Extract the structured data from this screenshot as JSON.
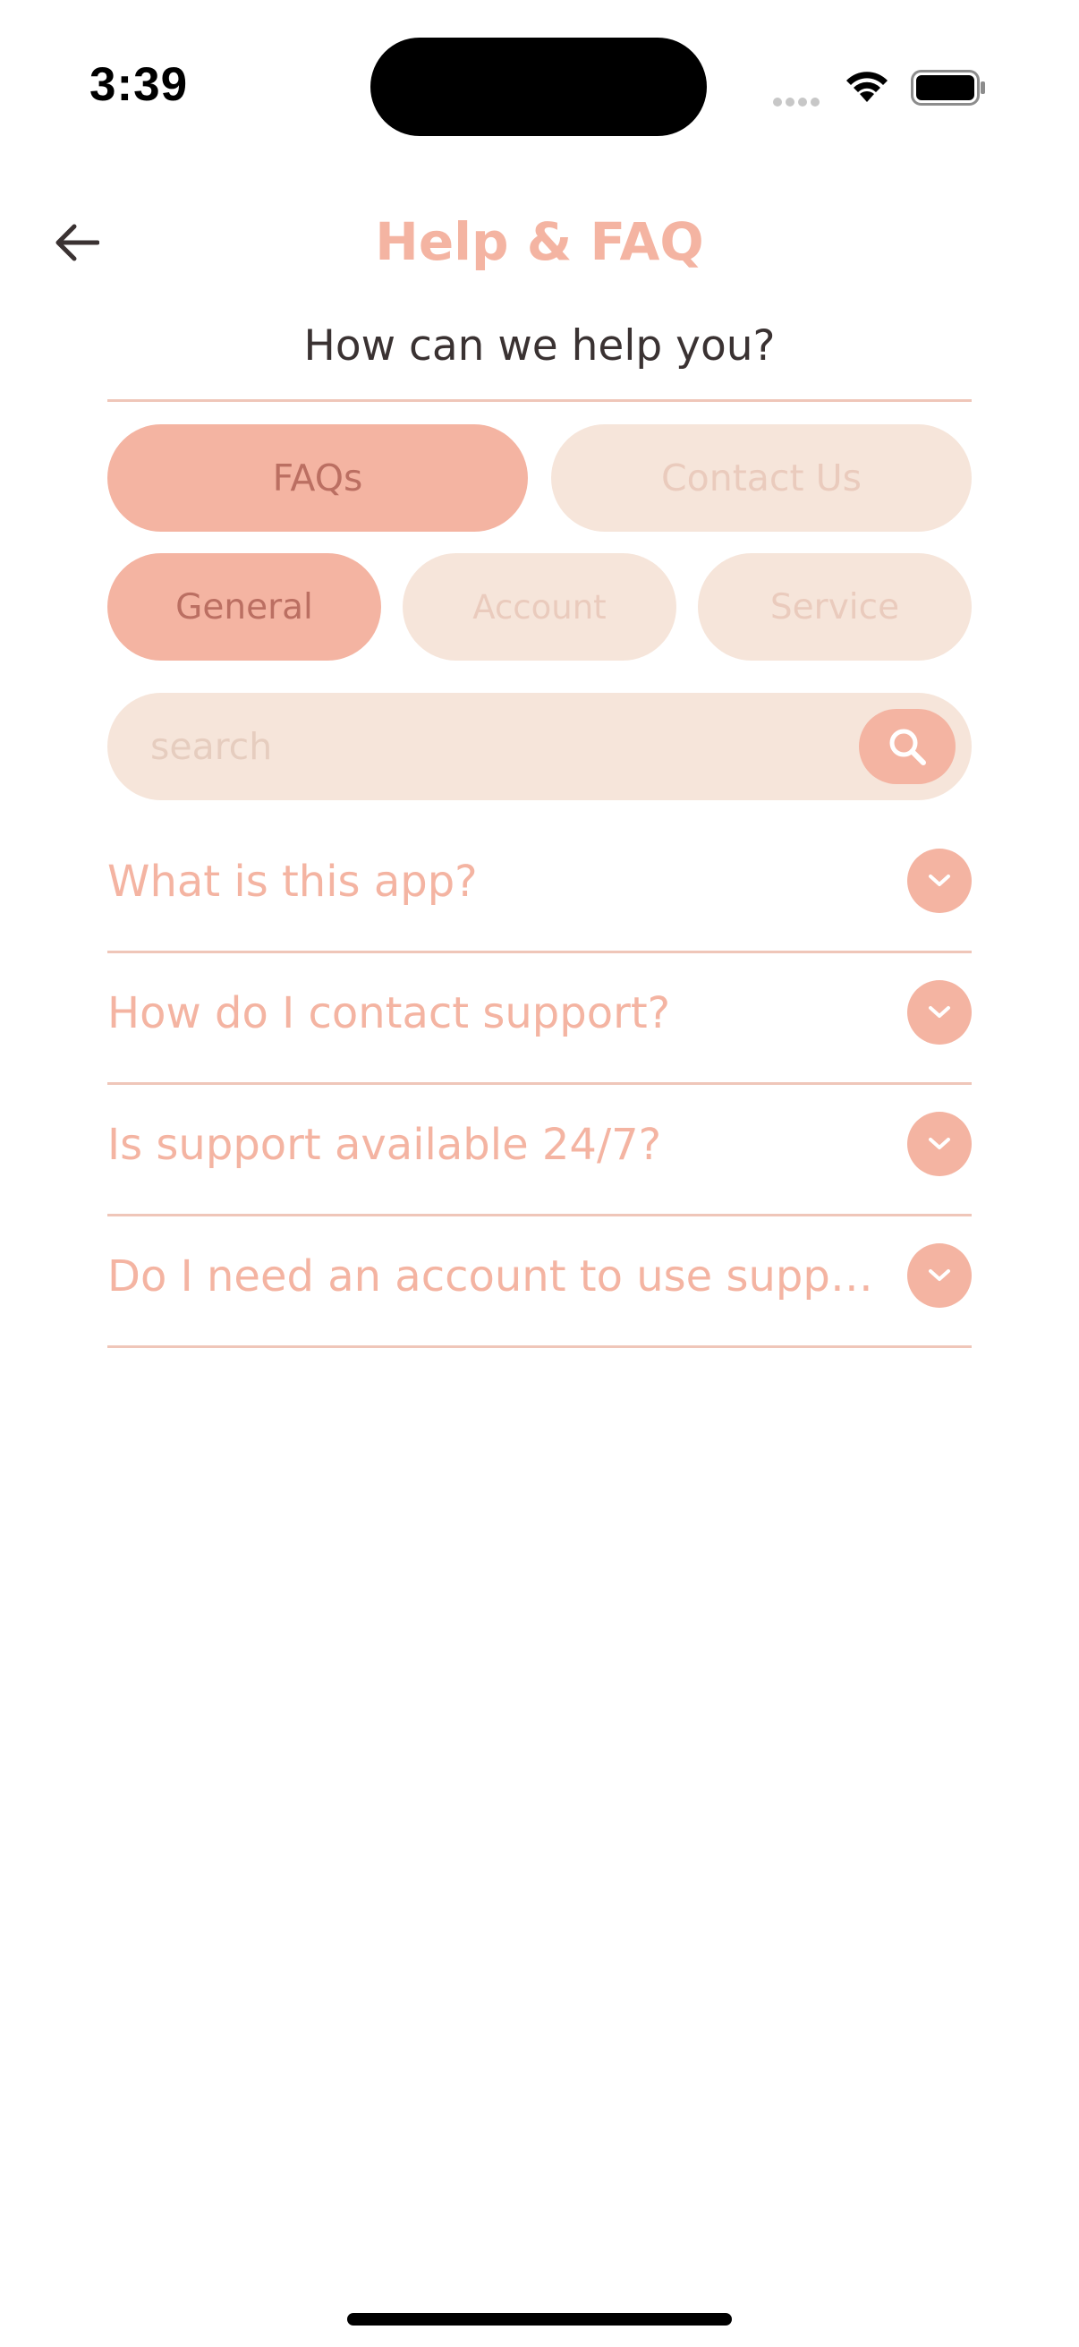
{
  "status_bar": {
    "time": "3:39",
    "icons": [
      "signal-dots-icon",
      "wifi-icon",
      "battery-icon"
    ]
  },
  "header": {
    "back_icon": "arrow-left-icon",
    "title": "Help & FAQ",
    "subtitle": "How can we help you?"
  },
  "tabs": [
    {
      "label": "FAQs",
      "active": true
    },
    {
      "label": "Contact Us",
      "active": false
    }
  ],
  "categories": [
    {
      "label": "General",
      "active": true
    },
    {
      "label": "Account",
      "active": false
    },
    {
      "label": "Service",
      "active": false
    }
  ],
  "search": {
    "placeholder": "search",
    "value": "",
    "icon": "search-icon"
  },
  "faqs": [
    {
      "question": "What is this app?"
    },
    {
      "question": "How do I contact support?"
    },
    {
      "question": "Is support available 24/7?"
    },
    {
      "question": "Do I need an account to use supp…"
    }
  ],
  "colors": {
    "accent": "#f4b4a2",
    "accent_light": "#f6e5da",
    "active_text": "#bb6f62",
    "inactive_text": "#eacbbd",
    "divider": "#efc6b9",
    "subtitle_text": "#3a3232"
  }
}
